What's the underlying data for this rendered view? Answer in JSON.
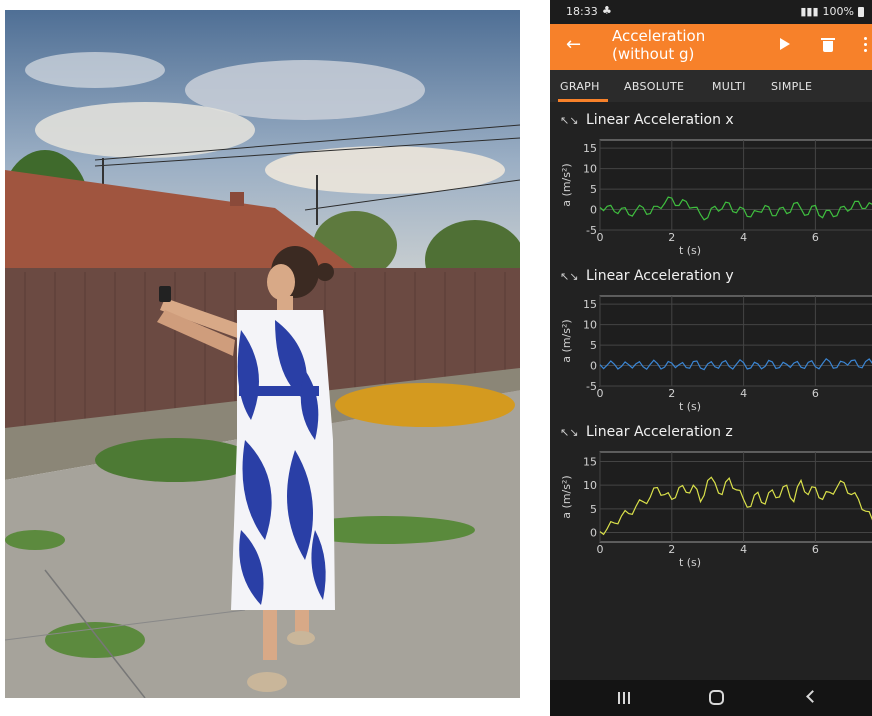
{
  "status": {
    "time": "18:33",
    "battery": "100%"
  },
  "appbar": {
    "title": "Acceleration\n(without g)",
    "title_line1": "Acceleration",
    "title_line2": "(without g)"
  },
  "tabs": [
    {
      "label": "GRAPH",
      "active": true
    },
    {
      "label": "ABSOLUTE",
      "active": false
    },
    {
      "label": "MULTI",
      "active": false
    },
    {
      "label": "SIMPLE",
      "active": false
    }
  ],
  "colors": {
    "accent": "#f7812a",
    "x_series": "#3fbf3f",
    "y_series": "#3b86d4",
    "z_series": "#d9e04a"
  },
  "chart_data": [
    {
      "type": "line",
      "title": "Linear Acceleration x",
      "xlabel": "t (s)",
      "ylabel": "a (m/s²)",
      "xlim": [
        0,
        7.8
      ],
      "ylim": [
        -5,
        17
      ],
      "xticks": [
        0,
        2,
        4,
        6
      ],
      "yticks": [
        -5,
        0,
        5,
        10,
        15
      ],
      "series": [
        {
          "color": "#3fbf3f",
          "x": [
            0,
            0.2,
            0.4,
            0.6,
            0.8,
            1.0,
            1.2,
            1.4,
            1.6,
            1.8,
            2.0,
            2.2,
            2.4,
            2.6,
            2.8,
            3.0,
            3.2,
            3.4,
            3.6,
            3.8,
            4.0,
            4.2,
            4.4,
            4.6,
            4.8,
            5.0,
            5.2,
            5.4,
            5.6,
            5.8,
            6.0,
            6.2,
            6.4,
            6.6,
            6.8,
            7.0,
            7.2,
            7.4,
            7.6,
            7.8
          ],
          "y": [
            0.5,
            0.8,
            -0.5,
            0.3,
            -1.2,
            -0.2,
            0.5,
            -1.0,
            0.8,
            1.5,
            2.8,
            1.0,
            2.0,
            0.5,
            -1.2,
            -2.0,
            0.8,
            0.2,
            1.6,
            -0.8,
            0.2,
            -1.8,
            -0.5,
            1.0,
            -1.5,
            0.3,
            -1.0,
            1.5,
            0.2,
            -1.2,
            1.0,
            -2.0,
            -0.2,
            -1.5,
            0.8,
            0.2,
            2.0,
            0.3,
            1.2,
            -0.5
          ]
        }
      ]
    },
    {
      "type": "line",
      "title": "Linear Acceleration y",
      "xlabel": "t (s)",
      "ylabel": "a (m/s²)",
      "xlim": [
        0,
        7.8
      ],
      "ylim": [
        -5,
        17
      ],
      "xticks": [
        0,
        2,
        4,
        6
      ],
      "yticks": [
        -5,
        0,
        5,
        10,
        15
      ],
      "series": [
        {
          "color": "#3b86d4",
          "x": [
            0,
            0.2,
            0.4,
            0.6,
            0.8,
            1.0,
            1.2,
            1.4,
            1.6,
            1.8,
            2.0,
            2.2,
            2.4,
            2.6,
            2.8,
            3.0,
            3.2,
            3.4,
            3.6,
            3.8,
            4.0,
            4.2,
            4.4,
            4.6,
            4.8,
            5.0,
            5.2,
            5.4,
            5.6,
            5.8,
            6.0,
            6.2,
            6.4,
            6.6,
            6.8,
            7.0,
            7.2,
            7.4,
            7.6,
            7.8
          ],
          "y": [
            0.2,
            0.1,
            0.3,
            -0.2,
            0.2,
            0.4,
            -0.3,
            0.3,
            0.5,
            -0.4,
            0.6,
            0.2,
            -0.5,
            1.0,
            -0.6,
            0.4,
            -0.3,
            0.8,
            -0.2,
            0.3,
            0.7,
            -0.6,
            0.4,
            -0.2,
            0.9,
            -0.5,
            0.3,
            0.6,
            -0.4,
            0.8,
            -0.3,
            0.5,
            1.0,
            -0.5,
            0.8,
            1.2,
            -0.3,
            1.0,
            0.4,
            1.3
          ]
        }
      ]
    },
    {
      "type": "line",
      "title": "Linear Acceleration z",
      "xlabel": "t (s)",
      "ylabel": "a (m/s²)",
      "xlim": [
        0,
        7.8
      ],
      "ylim": [
        -2,
        17
      ],
      "xticks": [
        0,
        2,
        4,
        6
      ],
      "yticks": [
        0,
        5,
        10,
        15
      ],
      "series": [
        {
          "color": "#d9e04a",
          "x": [
            0,
            0.2,
            0.4,
            0.6,
            0.8,
            1.0,
            1.2,
            1.4,
            1.6,
            1.8,
            2.0,
            2.2,
            2.4,
            2.6,
            2.8,
            3.0,
            3.2,
            3.4,
            3.6,
            3.8,
            4.0,
            4.2,
            4.4,
            4.6,
            4.8,
            5.0,
            5.2,
            5.4,
            5.6,
            5.8,
            6.0,
            6.2,
            6.4,
            6.6,
            6.8,
            7.0,
            7.2,
            7.4,
            7.6,
            7.8
          ],
          "y": [
            0.2,
            0.8,
            2.0,
            3.5,
            4.0,
            5.5,
            6.5,
            7.5,
            9.5,
            8.0,
            7.0,
            9.5,
            8.5,
            10.0,
            6.5,
            11.0,
            10.5,
            8.0,
            11.5,
            9.0,
            7.0,
            5.5,
            8.5,
            6.0,
            9.0,
            7.5,
            10.0,
            6.5,
            11.0,
            8.0,
            9.5,
            7.0,
            8.5,
            9.5,
            10.5,
            8.0,
            7.0,
            4.5,
            2.5,
            1.0
          ]
        }
      ]
    }
  ]
}
